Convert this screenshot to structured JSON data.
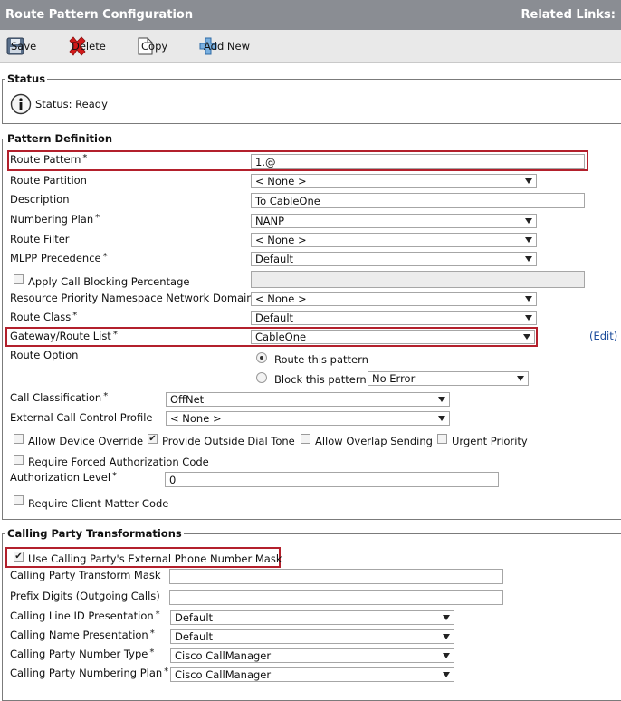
{
  "header": {
    "title": "Route Pattern Configuration",
    "related_links": "Related Links:"
  },
  "toolbar": {
    "save": "Save",
    "delete": "Delete",
    "copy": "Copy",
    "add_new": "Add New"
  },
  "status": {
    "legend": "Status",
    "text": "Status: Ready"
  },
  "pattern_definition": {
    "legend": "Pattern Definition",
    "route_pattern": {
      "label": "Route Pattern",
      "value": "1.@"
    },
    "route_partition": {
      "label": "Route Partition",
      "value": "< None >"
    },
    "description": {
      "label": "Description",
      "value": "To CableOne"
    },
    "numbering_plan": {
      "label": "Numbering Plan",
      "value": "NANP"
    },
    "route_filter": {
      "label": "Route Filter",
      "value": "< None >"
    },
    "mlpp_precedence": {
      "label": "MLPP Precedence",
      "value": "Default"
    },
    "apply_call_blocking": {
      "label": "Apply Call Blocking Percentage"
    },
    "resource_priority": {
      "label": "Resource Priority Namespace Network Domain",
      "value": "< None >"
    },
    "route_class": {
      "label": "Route Class",
      "value": "Default"
    },
    "gateway_route_list": {
      "label": "Gateway/Route List",
      "value": "CableOne",
      "edit": "(Edit)"
    },
    "route_option": {
      "label": "Route Option",
      "route_this": "Route this pattern",
      "block_this": "Block this pattern",
      "block_reason": "No Error"
    },
    "call_classification": {
      "label": "Call Classification",
      "value": "OffNet"
    },
    "external_call_control": {
      "label": "External Call Control Profile",
      "value": "< None >"
    },
    "allow_device_override": "Allow Device Override",
    "provide_outside_dial_tone": "Provide Outside Dial Tone",
    "allow_overlap_sending": "Allow Overlap Sending",
    "urgent_priority": "Urgent Priority",
    "require_forced_auth": "Require Forced Authorization Code",
    "authorization_level": {
      "label": "Authorization Level",
      "value": "0"
    },
    "require_client_matter": "Require Client Matter Code"
  },
  "calling_party": {
    "legend": "Calling Party Transformations",
    "use_external_mask": "Use Calling Party's External Phone Number Mask",
    "transform_mask": {
      "label": "Calling Party Transform Mask",
      "value": ""
    },
    "prefix_digits": {
      "label": "Prefix Digits (Outgoing Calls)",
      "value": ""
    },
    "line_id_presentation": {
      "label": "Calling Line ID Presentation",
      "value": "Default"
    },
    "name_presentation": {
      "label": "Calling Name Presentation",
      "value": "Default"
    },
    "number_type": {
      "label": "Calling Party Number Type",
      "value": "Cisco CallManager"
    },
    "numbering_plan": {
      "label": "Calling Party Numbering Plan",
      "value": "Cisco CallManager"
    }
  }
}
